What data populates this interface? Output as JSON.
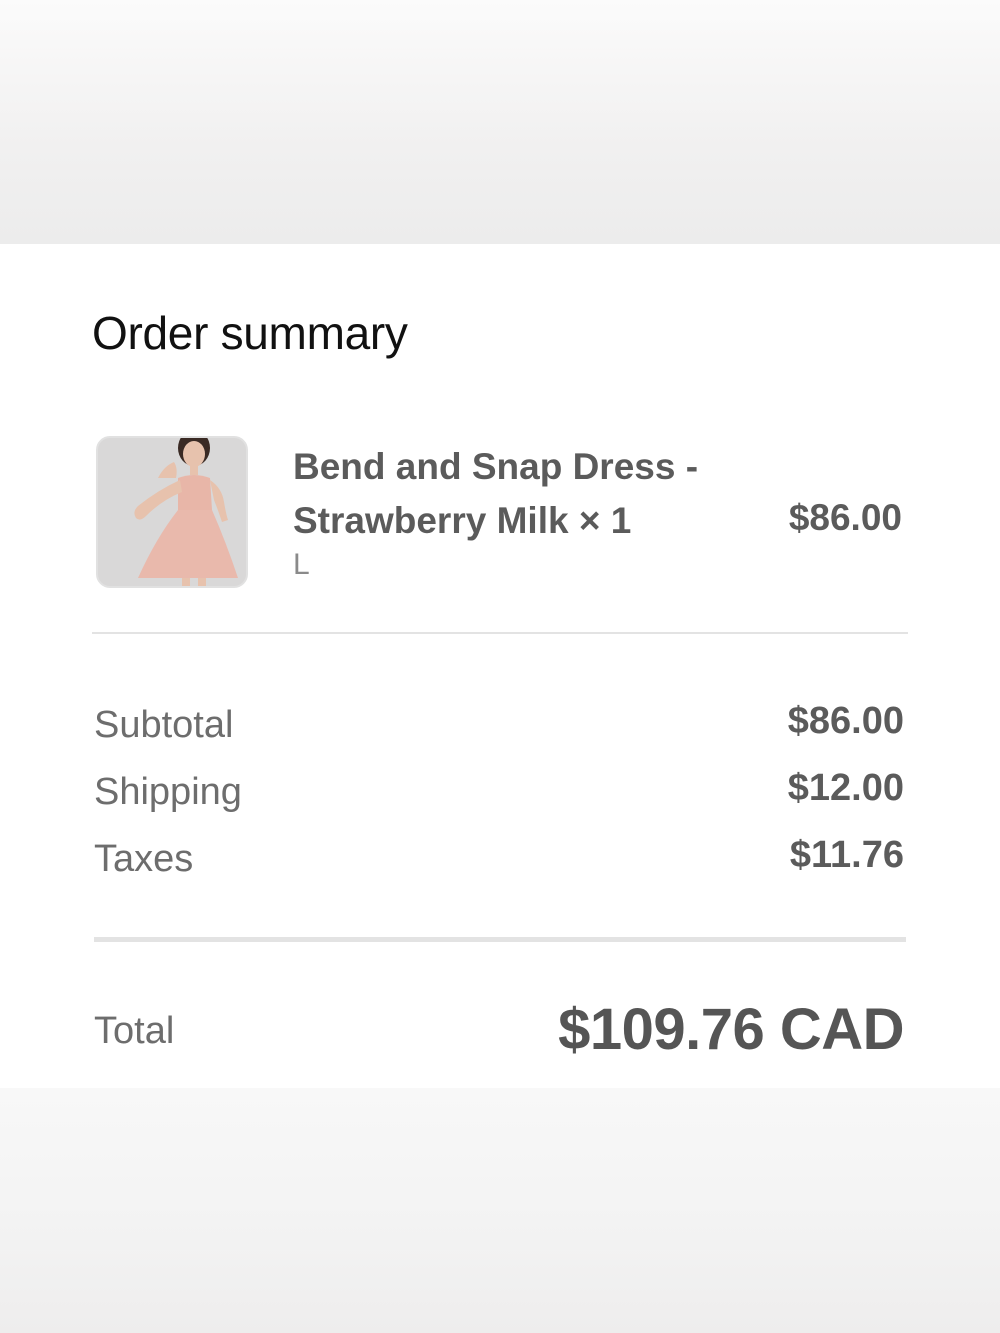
{
  "summary": {
    "title": "Order summary"
  },
  "line_item": {
    "name": "Bend and Snap Dress - Strawberry Milk × 1",
    "variant": "L",
    "price": "$86.00",
    "image_icon": "product-thumbnail"
  },
  "totals": {
    "subtotal_label": "Subtotal",
    "subtotal_value": "$86.00",
    "shipping_label": "Shipping",
    "shipping_value": "$12.00",
    "taxes_label": "Taxes",
    "taxes_value": "$11.76",
    "total_label": "Total",
    "total_value": "$109.76 CAD"
  }
}
